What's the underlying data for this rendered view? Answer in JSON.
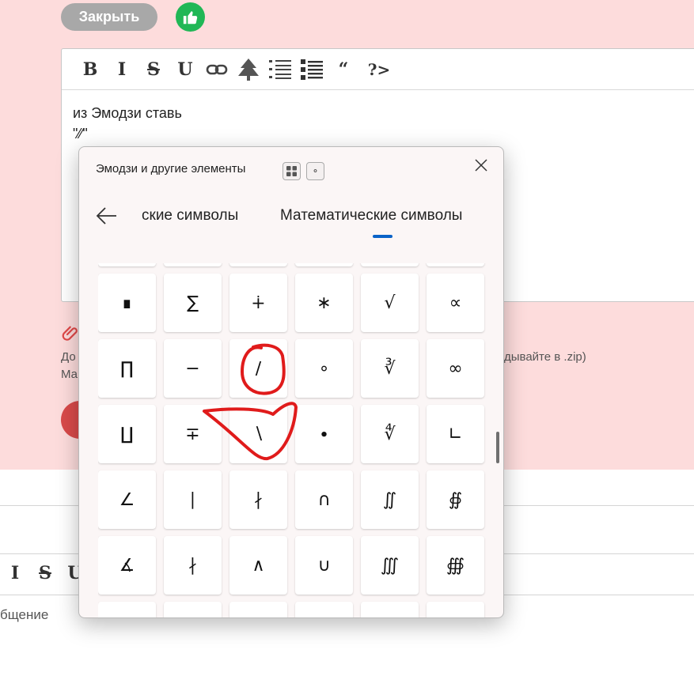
{
  "page": {
    "close_label": "Закрыть",
    "editor_toolbar": [
      "B",
      "I",
      "S",
      "U",
      "∞",
      "🌲",
      "≡",
      "☰",
      "“",
      "?>"
    ],
    "editor_text_line1": "из Эмодзи ставь",
    "editor_text_line2": "\"⁄⁄\"",
    "help_line1_left": "До",
    "help_line1_right": "дывайте в .zip)",
    "help_line2_left": "Ма",
    "toolbar2": [
      "I",
      "S",
      "U"
    ],
    "message_placeholder": "бщение"
  },
  "panel": {
    "title": "Эмодзи и другие элементы",
    "mini_btn_2": "⚬",
    "tab_prev": "ские символы",
    "tab_current": "Математические символы",
    "symbols": [
      [
        "",
        "",
        "",
        "",
        "",
        ""
      ],
      [
        "∎",
        "∑",
        "∔",
        "∗",
        "√",
        "∝"
      ],
      [
        "∏",
        "−",
        "∕",
        "∘",
        "∛",
        "∞"
      ],
      [
        "∐",
        "∓",
        "∖",
        "∙",
        "∜",
        "∟"
      ],
      [
        "∠",
        "∣",
        "∤",
        "∩",
        "∬",
        "∯"
      ],
      [
        "∡",
        "∤",
        "∧",
        "∪",
        "∭",
        "∰"
      ],
      [
        "",
        "",
        "",
        "",
        "",
        ""
      ]
    ]
  },
  "colors": {
    "page_pink": "#fddcdc",
    "close_btn": "#a8a8a8",
    "like_btn": "#20b756",
    "accent_blue": "#0a63c8",
    "annotation_red": "#e01b1b"
  }
}
